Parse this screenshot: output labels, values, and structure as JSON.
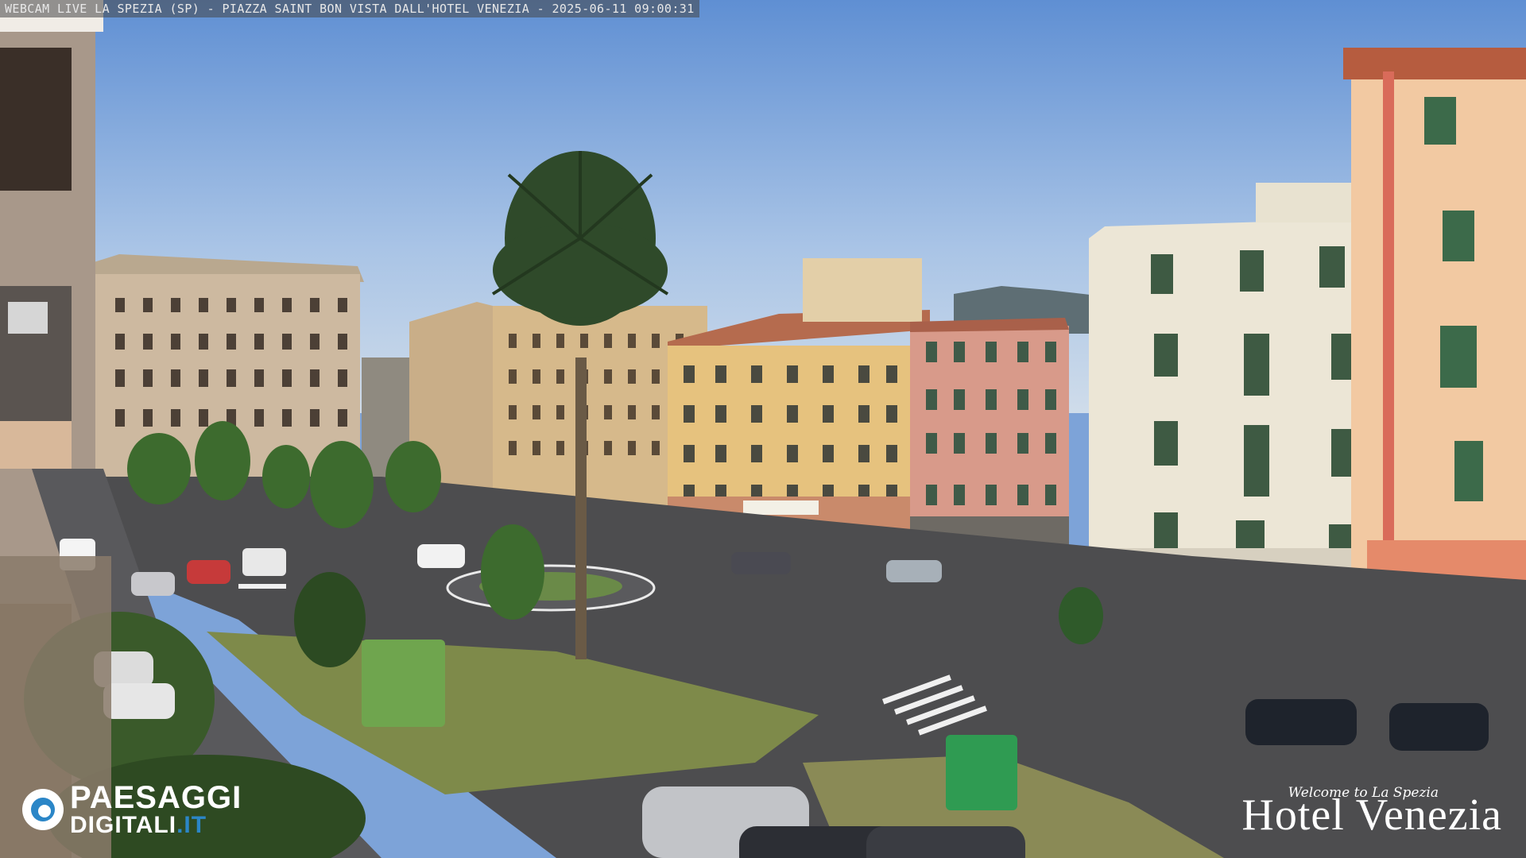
{
  "overlay": {
    "caption": "WEBCAM LIVE LA SPEZIA (SP) - PIAZZA SAINT BON VISTA DALL'HOTEL VENEZIA - 2025-06-11 09:00:31"
  },
  "logos": {
    "left_line1": "PAESAGGI",
    "left_line2": "DIGITALI",
    "left_suffix": ".IT",
    "right_welcome": "Welcome to La Spezia",
    "right_name": "Hotel Venezia"
  },
  "colors": {
    "sky": "#7da3d8",
    "logo_blue": "#2b86c7"
  }
}
